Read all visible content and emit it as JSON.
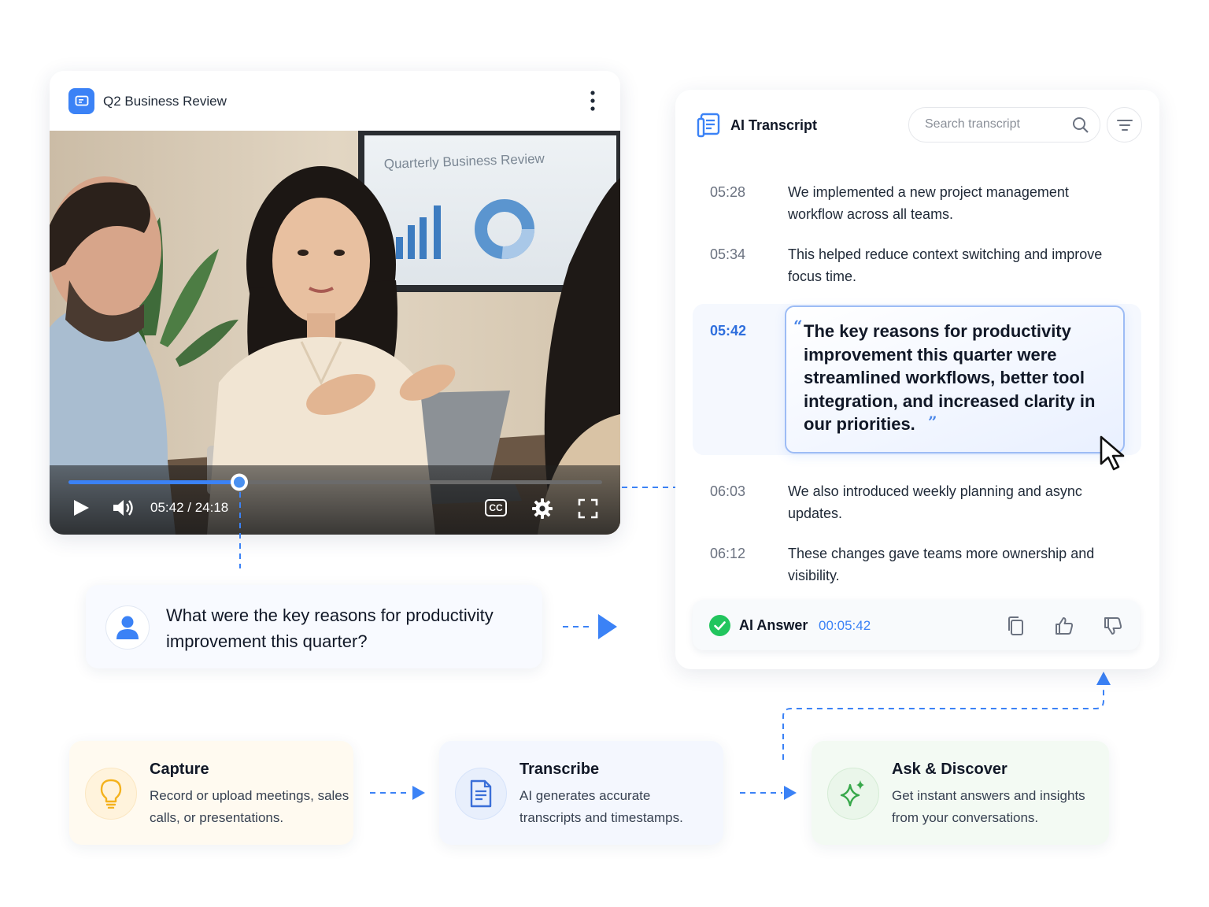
{
  "video": {
    "title": "Q2 Business Review",
    "screen_heading": "Quarterly Business Review",
    "time_display": "05:42 / 24:18",
    "cc_label": "CC",
    "progress": 0.32
  },
  "transcript": {
    "title": "AI Transcript",
    "search_placeholder": "Search transcript",
    "lines": [
      {
        "time": "05:28",
        "text": "We implemented a new project management workflow across all teams."
      },
      {
        "time": "05:34",
        "text": "This helped reduce context switching and improve focus time."
      },
      {
        "time": "05:42",
        "text": "The key reasons for productivity improvement this quarter were streamlined workflows, better tool integration, and increased clarity in our priorities."
      },
      {
        "time": "06:03",
        "text": "We also introduced weekly planning and async updates."
      },
      {
        "time": "06:12",
        "text": "These changes gave teams more ownership and visibility."
      }
    ],
    "answer": {
      "label": "AI Answer",
      "timestamp": "00:05:42"
    }
  },
  "question": {
    "text": "What were the key reasons for productivity improvement this quarter?"
  },
  "steps": [
    {
      "title": "Capture",
      "desc": "Record or upload meetings, sales calls, or presentations."
    },
    {
      "title": "Transcribe",
      "desc": "AI generates accurate transcripts and timestamps."
    },
    {
      "title": "Ask & Discover",
      "desc": "Get instant answers and insights from your conversations."
    }
  ],
  "colors": {
    "accent": "#3b82f6",
    "success": "#22c55e",
    "capture_bg": "#fffaf0",
    "transcribe_bg": "#f4f7fe",
    "discover_bg": "#f3faf3"
  },
  "icons": {
    "app": "presentation-icon",
    "menu": "kebab-menu-icon",
    "transcript": "document-icon",
    "search": "search-icon",
    "filter": "filter-icon",
    "check": "check-circle-icon",
    "copy": "copy-icon",
    "like": "thumbs-up-icon",
    "dislike": "thumbs-down-icon",
    "user": "user-icon",
    "capture": "lightbulb-icon",
    "transcribe": "document-icon",
    "discover": "sparkle-icon"
  }
}
